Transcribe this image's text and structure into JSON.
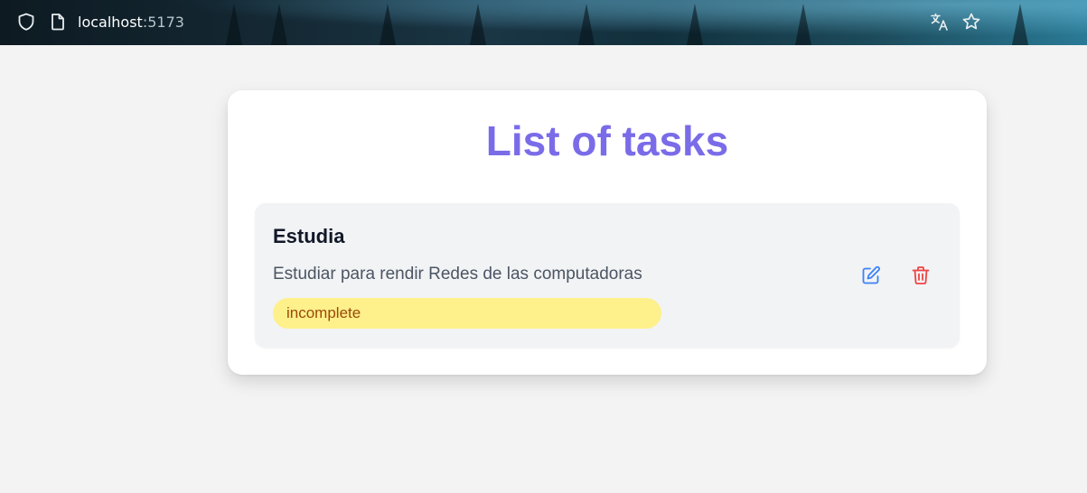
{
  "browser": {
    "url_host": "localhost",
    "url_port": ":5173",
    "icons": [
      "shield-icon",
      "page-icon",
      "translate-icon",
      "star-icon"
    ]
  },
  "page": {
    "title": "List of tasks",
    "title_color": "#7a6ce8"
  },
  "tasks": [
    {
      "title": "Estudia",
      "description": "Estudiar para rendir Redes de las computadoras",
      "status": "incomplete",
      "status_color": "#fef08a",
      "edit_icon": "edit-icon",
      "delete_icon": "trash-icon"
    }
  ],
  "colors": {
    "edit": "#3b82f6",
    "delete": "#ef4444"
  }
}
